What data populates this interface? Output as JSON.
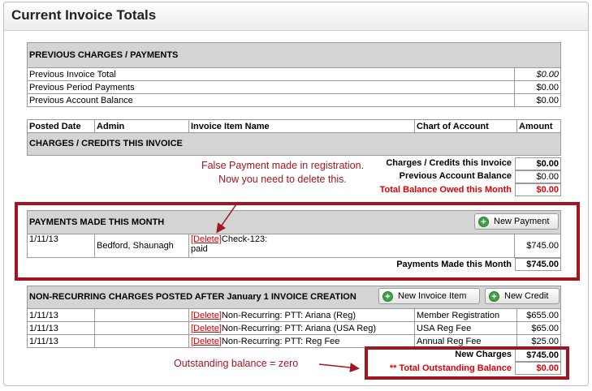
{
  "title": "Current Invoice Totals",
  "previous": {
    "header": "PREVIOUS CHARGES / PAYMENTS",
    "rows": [
      {
        "label": "Previous Invoice Total",
        "value": "$0.00"
      },
      {
        "label": "Previous Period Payments",
        "value": "$0.00"
      },
      {
        "label": "Previous Account Balance",
        "value": "$0.00"
      }
    ]
  },
  "columns": [
    "Posted Date",
    "Admin",
    "Invoice Item Name",
    "Chart of Account",
    "Amount"
  ],
  "charges": {
    "header": "CHARGES / CREDITS THIS INVOICE",
    "summary": [
      {
        "label": "Charges / Credits this Invoice",
        "value": "$0.00"
      },
      {
        "label": "Previous Account Balance",
        "value": "$0.00"
      },
      {
        "label": "Total Balance Owed this Month",
        "value": "$0.00"
      }
    ]
  },
  "annotation1": "False Payment made in registration.  Now you need to delete this.",
  "payments": {
    "header": "PAYMENTS MADE THIS MONTH",
    "new_button": "New Payment",
    "row": {
      "date": "1/11/13",
      "admin": "Bedford, Shaunagh",
      "delete": "[Delete]",
      "item": "Check-123:",
      "item2": "paid",
      "amount": "$745.00"
    },
    "total_label": "Payments Made this Month",
    "total_value": "$745.00"
  },
  "nonrecurring": {
    "header": "NON-RECURRING CHARGES POSTED AFTER January 1 INVOICE CREATION",
    "new_item_button": "New Invoice Item",
    "new_credit_button": "New Credit",
    "rows": [
      {
        "date": "1/11/13",
        "delete": "[Delete]",
        "item": "Non-Recurring: PTT: Ariana (Reg)",
        "account": "Member Registration",
        "amount": "$655.00"
      },
      {
        "date": "1/11/13",
        "delete": "[Delete]",
        "item": "Non-Recurring: PTT: Ariana (USA Reg)",
        "account": "USA Reg Fee",
        "amount": "$65.00"
      },
      {
        "date": "1/11/13",
        "delete": "[Delete]",
        "item": "Non-Recurring: PTT: Reg Fee",
        "account": "Annual Reg Fee",
        "amount": "$25.00"
      }
    ],
    "new_charges_label": "New Charges",
    "new_charges_value": "$745.00",
    "outstanding_label": "** Total Outstanding Balance",
    "outstanding_value": "$0.00"
  },
  "annotation2": "Outstanding balance = zero",
  "colors": {
    "highlight": "#a31521",
    "delete": "#d00000",
    "header_bg": "#d4d4d4"
  }
}
